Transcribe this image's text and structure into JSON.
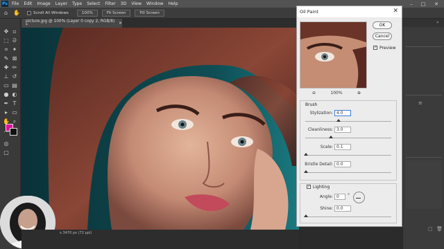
{
  "menubar": {
    "logo": "Ps",
    "items": [
      "File",
      "Edit",
      "Image",
      "Layer",
      "Type",
      "Select",
      "Filter",
      "3D",
      "View",
      "Window",
      "Help"
    ]
  },
  "options_bar": {
    "scroll_all_windows": "Scroll All Windows",
    "zoom_100": "100%",
    "fit_screen": "Fit Screen",
    "fill_screen": "Fill Screen"
  },
  "document": {
    "tab_label": "picture.jpg @ 100% (Layer 0 copy 2, RGB/8) *",
    "status": "x 3470 px (72 ppi)"
  },
  "colors": {
    "foreground": "#e0109a",
    "background": "#111111",
    "canvas_bg": "#0d4148"
  },
  "dialog": {
    "title": "Oil Paint",
    "ok": "OK",
    "cancel": "Cancel",
    "preview_label": "Preview",
    "preview_checked": true,
    "zoom": "100%",
    "brush_title": "Brush",
    "stylization_label": "Stylization:",
    "stylization_value": "4.0",
    "cleanliness_label": "Cleanliness:",
    "cleanliness_value": "3.0",
    "scale_label": "Scale:",
    "scale_value": "0.1",
    "bristle_label": "Bristle Detail:",
    "bristle_value": "0.0",
    "lighting_label": "Lighting",
    "lighting_checked": true,
    "angle_label": "Angle:",
    "angle_value": "0",
    "angle_unit": "°",
    "shine_label": "Shine:",
    "shine_value": "0.0"
  }
}
